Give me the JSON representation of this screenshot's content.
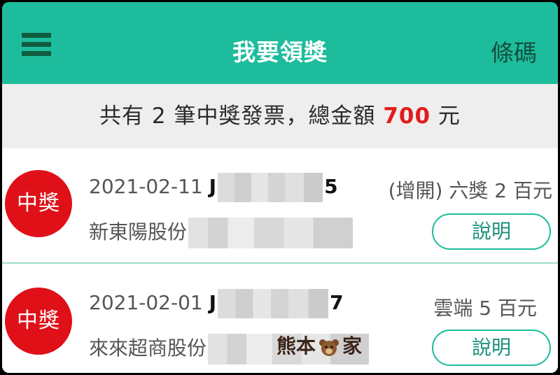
{
  "header": {
    "menu_icon": "hamburger-menu-icon",
    "title": "我要領獎",
    "barcode_label": "條碼"
  },
  "summary": {
    "prefix": "共有 2 筆中獎發票，總金額 ",
    "amount": "700",
    "suffix": " 元",
    "amount_color": "#e21b1b"
  },
  "invoices": [
    {
      "badge": "中獎",
      "date": "2021-02-11",
      "invoice_prefix": "J",
      "invoice_suffix": "5",
      "store": "新東陽股份",
      "prize": "(增開) 六獎 2 百元",
      "detail_label": "說明"
    },
    {
      "badge": "中獎",
      "date": "2021-02-01",
      "invoice_prefix": "J",
      "invoice_suffix": "7",
      "store": "來來超商股份",
      "prize": "雲端 5 百元",
      "detail_label": "說明"
    }
  ],
  "watermark": {
    "text_left": "熊本",
    "text_right": "家"
  },
  "colors": {
    "app_bar": "#1dbc9c",
    "badge": "#e01018",
    "summary_bg": "#eeeeee"
  }
}
